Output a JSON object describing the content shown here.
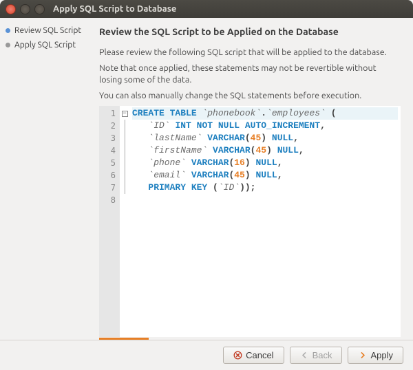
{
  "window": {
    "title": "Apply SQL Script to Database"
  },
  "steps": [
    {
      "label": "Review SQL Script",
      "active": true
    },
    {
      "label": "Apply SQL Script",
      "active": false
    }
  ],
  "main": {
    "heading": "Review the SQL Script to be Applied on the Database",
    "desc1": "Please review the following SQL script that will be applied to the database.",
    "desc2": "Note that once applied, these statements may not be revertible without losing some of the data.",
    "desc3": "You can also manually change the SQL statements before execution."
  },
  "editor": {
    "line_numbers": [
      "1",
      "2",
      "3",
      "4",
      "5",
      "6",
      "7",
      "8"
    ],
    "tokens": [
      [
        {
          "t": "CREATE TABLE",
          "c": "kw"
        },
        {
          "t": " ",
          "c": ""
        },
        {
          "t": "`phonebook`",
          "c": "id"
        },
        {
          "t": ".",
          "c": "pn"
        },
        {
          "t": "`employees`",
          "c": "id"
        },
        {
          "t": " ",
          "c": ""
        },
        {
          "t": "(",
          "c": "pn"
        }
      ],
      [
        {
          "t": "   ",
          "c": ""
        },
        {
          "t": "`ID`",
          "c": "id"
        },
        {
          "t": " ",
          "c": ""
        },
        {
          "t": "INT NOT NULL AUTO_INCREMENT",
          "c": "kw"
        },
        {
          "t": ",",
          "c": "pn"
        }
      ],
      [
        {
          "t": "   ",
          "c": ""
        },
        {
          "t": "`lastName`",
          "c": "id"
        },
        {
          "t": " ",
          "c": ""
        },
        {
          "t": "VARCHAR",
          "c": "kw"
        },
        {
          "t": "(",
          "c": "pn"
        },
        {
          "t": "45",
          "c": "num"
        },
        {
          "t": ")",
          "c": "pn"
        },
        {
          "t": " ",
          "c": ""
        },
        {
          "t": "NULL",
          "c": "kw"
        },
        {
          "t": ",",
          "c": "pn"
        }
      ],
      [
        {
          "t": "   ",
          "c": ""
        },
        {
          "t": "`firstName`",
          "c": "id"
        },
        {
          "t": " ",
          "c": ""
        },
        {
          "t": "VARCHAR",
          "c": "kw"
        },
        {
          "t": "(",
          "c": "pn"
        },
        {
          "t": "45",
          "c": "num"
        },
        {
          "t": ")",
          "c": "pn"
        },
        {
          "t": " ",
          "c": ""
        },
        {
          "t": "NULL",
          "c": "kw"
        },
        {
          "t": ",",
          "c": "pn"
        }
      ],
      [
        {
          "t": "   ",
          "c": ""
        },
        {
          "t": "`phone`",
          "c": "id"
        },
        {
          "t": " ",
          "c": ""
        },
        {
          "t": "VARCHAR",
          "c": "kw"
        },
        {
          "t": "(",
          "c": "pn"
        },
        {
          "t": "16",
          "c": "num"
        },
        {
          "t": ")",
          "c": "pn"
        },
        {
          "t": " ",
          "c": ""
        },
        {
          "t": "NULL",
          "c": "kw"
        },
        {
          "t": ",",
          "c": "pn"
        }
      ],
      [
        {
          "t": "   ",
          "c": ""
        },
        {
          "t": "`email`",
          "c": "id"
        },
        {
          "t": " ",
          "c": ""
        },
        {
          "t": "VARCHAR",
          "c": "kw"
        },
        {
          "t": "(",
          "c": "pn"
        },
        {
          "t": "45",
          "c": "num"
        },
        {
          "t": ")",
          "c": "pn"
        },
        {
          "t": " ",
          "c": ""
        },
        {
          "t": "NULL",
          "c": "kw"
        },
        {
          "t": ",",
          "c": "pn"
        }
      ],
      [
        {
          "t": "   ",
          "c": ""
        },
        {
          "t": "PRIMARY KEY",
          "c": "kw"
        },
        {
          "t": " (",
          "c": "pn"
        },
        {
          "t": "`ID`",
          "c": "id"
        },
        {
          "t": "));",
          "c": "pn"
        }
      ],
      [
        {
          "t": " ",
          "c": ""
        }
      ]
    ]
  },
  "buttons": {
    "cancel": "Cancel",
    "back": "Back",
    "apply": "Apply"
  }
}
